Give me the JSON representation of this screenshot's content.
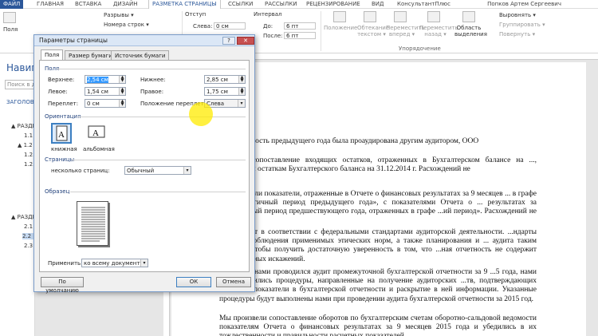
{
  "tabs": [
    "ФАЙЛ",
    "ГЛАВНАЯ",
    "ВСТАВКА",
    "ДИЗАЙН",
    "РАЗМЕТКА СТРАНИЦЫ",
    "ССЫЛКИ",
    "РАССЫЛКИ",
    "РЕЦЕНЗИРОВАНИЕ",
    "ВИД",
    "КонсультантПлюс"
  ],
  "user": "Попков Артем Сергеевич",
  "ribbon": {
    "fields": "Поля",
    "breaks": "Разрывы ▾",
    "line_numbers": "Номера строк ▾",
    "indent_title": "Отступ",
    "indent_left_label": "Слева:",
    "indent_left": "0 см",
    "interval_title": "Интервал",
    "before_label": "До:",
    "before": "6 пт",
    "after_label": "После:",
    "after": "6 пт",
    "position": "Положение",
    "wrap": "Обтекание текстом ▾",
    "forward": "Переместить вперед ▾",
    "backward": "Переместить назад ▾",
    "selpane": "Область выделения",
    "align": "Выровнять ▾",
    "group": "Группировать ▾",
    "rotate": "Повернуть ▾",
    "group_label": "Упорядочение"
  },
  "nav": {
    "title": "Навиг",
    "search_placeholder": "Поиск в доку",
    "headings": "ЗАГОЛОВ",
    "items": [
      "▲ РАЗДЕ",
      "1.1",
      "▲ 1.2",
      "1.2.",
      "1.2.",
      "▲ РАЗДЕ",
      "2.1",
      "2.2",
      "2.3"
    ]
  },
  "dialog": {
    "title": "Параметры страницы",
    "help": "?",
    "close": "✕",
    "tabs": [
      "Поля",
      "Размер бумаги",
      "Источник бумаги"
    ],
    "section_fields": "Поля",
    "top_label": "Верхнее:",
    "top_value": "2,54 см",
    "bottom_label": "Нижнее:",
    "bottom_value": "2,85 см",
    "left_label": "Левое:",
    "left_value": "1,54 см",
    "right_label": "Правое:",
    "right_value": "1,75 см",
    "gutter_label": "Переплет:",
    "gutter_value": "0 см",
    "gutter_pos_label": "Положение переплета:",
    "gutter_pos_value": "Слева",
    "section_orientation": "Ориентация",
    "portrait": "книжная",
    "landscape": "альбомная",
    "section_pages": "Страницы",
    "multiple_label": "несколько страниц:",
    "multiple_value": "Обычный",
    "section_sample": "Образец",
    "apply_label": "Применить:",
    "apply_value": "ко всему документу",
    "default_btn": "По умолчанию",
    "ok_btn": "ОК",
    "cancel_btn": "Отмена"
  },
  "doc": {
    "p1": "...ая отчетность предыдущего года была проаудирована другим аудитором, ООО",
    "p2": "...ведено сопоставление входящих остатков, отраженных в Бухгалтерском балансе на ..., исходящим остаткам Бухгалтерского баланса на 31.12.2014 г. Расхождений не",
    "p3": "...опоставили показатели, отраженные в Отчете о финансовых результатах за 9 месяцев ... в графе «За аналогичный период предыдущего года», с показателями Отчета о ... результатах за аналогичный период предшествующего года, отраженных в графе ...ий период». Расхождений не выявлено.",
    "p4": "...или аудит в соответствии с федеральными стандартами аудиторской деятельности. ...ндарты требуют соблюдения применимых этических норм, а также планирования и ... аудита таким образом, чтобы получить достаточную уверенность в том, что ...ная отчетность не содержит существенных искажений.",
    "p5": "...тем, что нами проводился аудит промежуточной бухгалтерской отчетности за 9 ...5 года, нами не проводились процедуры, направленные на получение аудиторских ...тв, подтверждающих числовые показатели в бухгалтерской отчетности и раскрытие в ней информации. Указанные процедуры будут выполнены нами при проведении аудита бухгалтерской отчетности за 2015 год.",
    "p6": "Мы произвели сопоставление оборотов по бухгалтерским счетам оборотно-сальдовой ведомости показателям Отчета о финансовых результатах за 9 месяцев 2015 года и убедились в их тождественности и правильности расчетных показателей."
  }
}
